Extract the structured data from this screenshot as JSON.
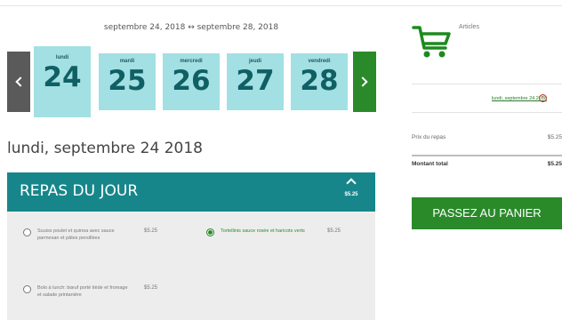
{
  "week": {
    "range_label": "septembre 24, 2018 ↔ septembre 28, 2018",
    "days": [
      {
        "name": "lundi",
        "num": "24"
      },
      {
        "name": "mardi",
        "num": "25"
      },
      {
        "name": "mercredi",
        "num": "26"
      },
      {
        "name": "jeudi",
        "num": "27"
      },
      {
        "name": "vendredi",
        "num": "28"
      }
    ],
    "active_index": 0
  },
  "selected_date": "lundi, septembre 24 2018",
  "panel": {
    "title": "REPAS DU JOUR",
    "price": "$5.25",
    "options": [
      {
        "text": "Suuiss poulet et quinoa avec sauce parmesan et pâtes persillées",
        "price": "$5.25",
        "selected": false
      },
      {
        "text": "Tortellinis sauce rosée et haricots verts",
        "price": "$5.25",
        "selected": true
      },
      {
        "text": "Bolo à lunch: bœuf porté tiède et fromage et salade printanière",
        "price": "$5.25",
        "selected": false
      }
    ]
  },
  "cart": {
    "label": "Articles",
    "date_link": "lundi, septembre 24 2018",
    "meal_price_label": "Prix du repas",
    "meal_price_value": "$5.25",
    "total_label": "Montant total",
    "total_value": "$5.25",
    "checkout_label": "PASSEZ AU PANIER"
  },
  "colors": {
    "teal": "#17868a",
    "light_teal": "#a3e0e3",
    "green": "#2a8a2a",
    "gray_nav": "#5a5a5a"
  },
  "icons": {
    "prev": "chevron-left-icon",
    "next": "chevron-right-icon",
    "cart": "shopping-cart-icon",
    "collapse": "chevron-up-icon",
    "remove": "remove-circle-icon"
  }
}
